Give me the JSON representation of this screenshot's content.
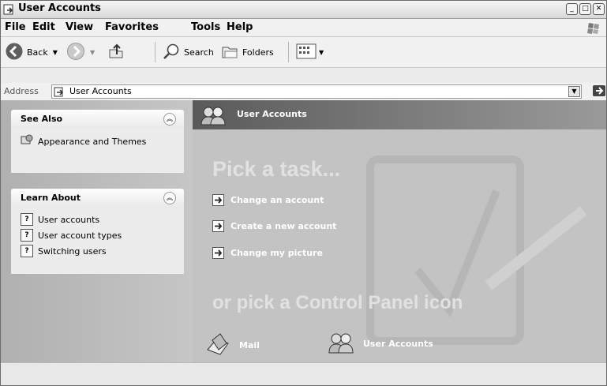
{
  "window": {
    "title": "User Accounts"
  },
  "menubar": {
    "items": [
      "File",
      "Edit",
      "View",
      "Favorites",
      "Tools",
      "Help"
    ]
  },
  "toolbar": {
    "back": "Back",
    "search": "Search",
    "folders": "Folders"
  },
  "address": {
    "label": "Address",
    "value": "User Accounts",
    "go": "Go"
  },
  "sidebar": {
    "see_also": {
      "title": "See Also",
      "items": [
        "Appearance and Themes"
      ]
    },
    "learn_about": {
      "title": "Learn About",
      "items": [
        "User accounts",
        "User account types",
        "Switching users"
      ]
    }
  },
  "main": {
    "header_title": "User Accounts",
    "pick_task_heading": "Pick a task...",
    "tasks": [
      "Change an account",
      "Create a new account",
      "Change my picture"
    ],
    "pick_icon_heading": "or pick a Control Panel icon",
    "icons": [
      "Mail",
      "User Accounts"
    ]
  }
}
